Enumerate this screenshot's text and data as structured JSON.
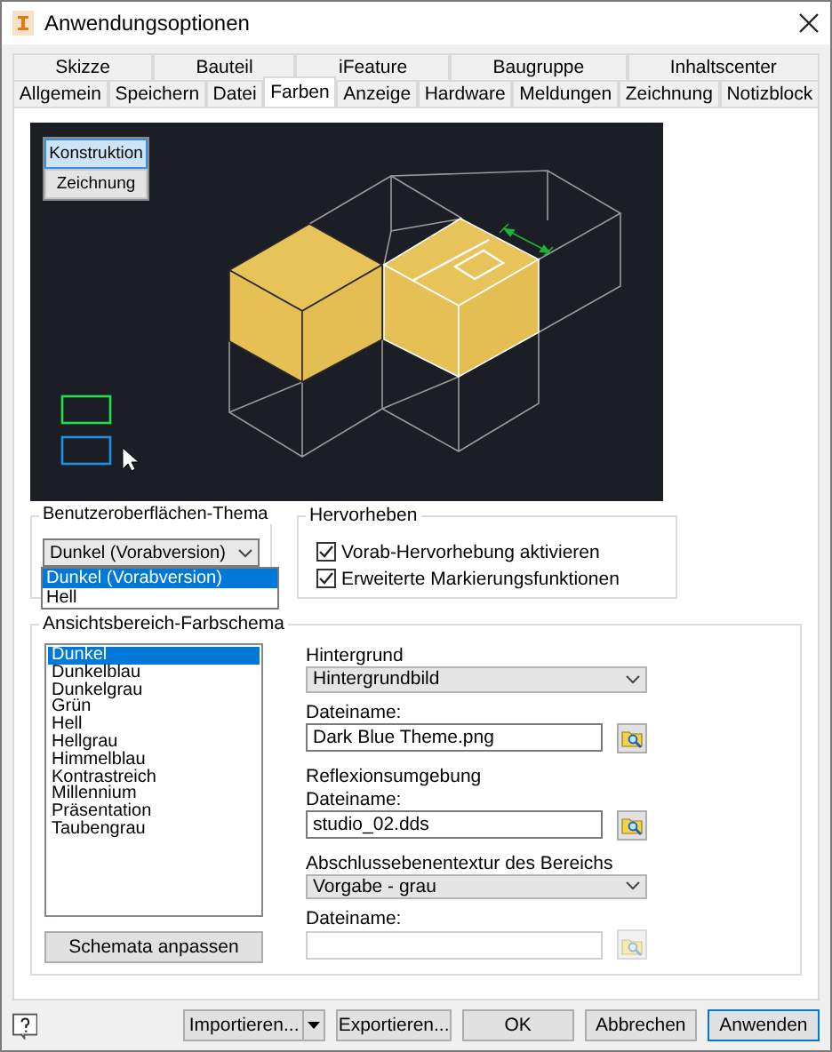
{
  "window": {
    "title": "Anwendungsoptionen"
  },
  "tab_rows": [
    [
      {
        "label": "Skizze",
        "selected": false
      },
      {
        "label": "Bauteil",
        "selected": false
      },
      {
        "label": "iFeature",
        "selected": false
      },
      {
        "label": "Baugruppe",
        "selected": false
      },
      {
        "label": "Inhaltscenter",
        "selected": false
      }
    ],
    [
      {
        "label": "Allgemein",
        "selected": false
      },
      {
        "label": "Speichern",
        "selected": false
      },
      {
        "label": "Datei",
        "selected": false
      },
      {
        "label": "Farben",
        "selected": true
      },
      {
        "label": "Anzeige",
        "selected": false
      },
      {
        "label": "Hardware",
        "selected": false
      },
      {
        "label": "Meldungen",
        "selected": false
      },
      {
        "label": "Zeichnung",
        "selected": false
      },
      {
        "label": "Notizblock",
        "selected": false
      }
    ]
  ],
  "preview": {
    "modes": [
      {
        "label": "Konstruktion",
        "selected": true
      },
      {
        "label": "Zeichnung",
        "selected": false
      }
    ]
  },
  "theme": {
    "title": "Benutzeroberflächen-Thema",
    "value": "Dunkel (Vorabversion)",
    "expanded": true,
    "options": [
      {
        "label": "Dunkel (Vorabversion)",
        "selected": true
      },
      {
        "label": "Hell",
        "selected": false
      }
    ]
  },
  "highlight": {
    "title": "Hervorheben",
    "checkboxes": [
      {
        "label": "Vorab-Hervorhebung aktivieren",
        "checked": true
      },
      {
        "label": "Erweiterte Markierungsfunktionen",
        "checked": true
      }
    ]
  },
  "scheme": {
    "title": "Ansichtsbereich-Farbschema",
    "items": [
      {
        "label": "Dunkel",
        "selected": true
      },
      {
        "label": "Dunkelblau",
        "selected": false
      },
      {
        "label": "Dunkelgrau",
        "selected": false
      },
      {
        "label": "Grün",
        "selected": false
      },
      {
        "label": "Hell",
        "selected": false
      },
      {
        "label": "Hellgrau",
        "selected": false
      },
      {
        "label": "Himmelblau",
        "selected": false
      },
      {
        "label": "Kontrastreich",
        "selected": false
      },
      {
        "label": "Millennium",
        "selected": false
      },
      {
        "label": "Präsentation",
        "selected": false
      },
      {
        "label": "Taubengrau",
        "selected": false
      }
    ],
    "button": "Schemata anpassen",
    "settings": [
      {
        "kind": "label",
        "text": "Hintergrund"
      },
      {
        "kind": "select",
        "value": "Hintergrundbild"
      },
      {
        "kind": "label",
        "text": "Dateiname:"
      },
      {
        "kind": "file",
        "value": "Dark Blue Theme.png",
        "disabled": false
      },
      {
        "kind": "heading",
        "text": "Reflexionsumgebung"
      },
      {
        "kind": "label",
        "text": "Dateiname:"
      },
      {
        "kind": "file",
        "value": "studio_02.dds",
        "disabled": false
      },
      {
        "kind": "heading",
        "text": "Abschlussebenentextur des Bereichs"
      },
      {
        "kind": "select",
        "value": "Vorgabe - grau"
      },
      {
        "kind": "label",
        "text": "Dateiname:"
      },
      {
        "kind": "file",
        "disabled": true
      }
    ]
  },
  "footer": {
    "buttons": [
      {
        "label": "Importieren...",
        "kind": "split",
        "default": false
      },
      {
        "label": "Exportieren...",
        "kind": "plain",
        "default": false
      },
      {
        "label": "OK",
        "kind": "plain",
        "default": false
      },
      {
        "label": "Abbrechen",
        "kind": "plain",
        "default": false
      },
      {
        "label": "Anwenden",
        "kind": "plain",
        "default": true
      }
    ]
  }
}
